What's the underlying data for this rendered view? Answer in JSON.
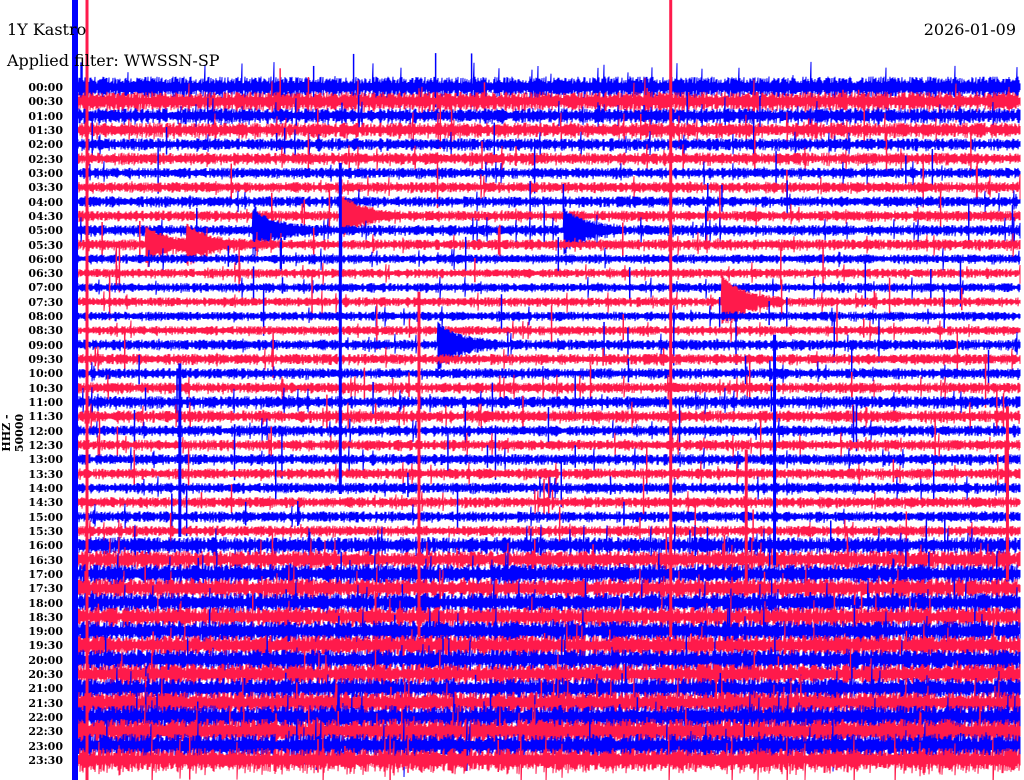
{
  "header": {
    "station": "1Y Kastro",
    "filter": "Applied filter: WWSSN-SP",
    "date": "2026-01-09"
  },
  "chart_data": {
    "type": "line",
    "title": "1Y Kastro helicorder",
    "channel_label": "HHZ - 50000",
    "minutes_per_line": 30,
    "row_labels": [
      "00:00",
      "00:30",
      "01:00",
      "01:30",
      "02:00",
      "02:30",
      "03:00",
      "03:30",
      "04:00",
      "04:30",
      "05:00",
      "05:30",
      "06:00",
      "06:30",
      "07:00",
      "07:30",
      "08:00",
      "08:30",
      "09:00",
      "09:30",
      "10:00",
      "10:30",
      "11:00",
      "11:30",
      "12:00",
      "12:30",
      "13:00",
      "13:30",
      "14:00",
      "14:30",
      "15:00",
      "15:30",
      "16:00",
      "16:30",
      "17:00",
      "17:30",
      "18:00",
      "18:30",
      "19:00",
      "19:30",
      "20:00",
      "20:30",
      "21:00",
      "21:30",
      "22:00",
      "22:30",
      "23:00",
      "23:30"
    ],
    "colors": [
      "#0000ff",
      "#ff1a4b"
    ],
    "relative_noise": [
      1.4,
      1.3,
      1.0,
      1.0,
      0.8,
      0.8,
      0.7,
      0.7,
      0.7,
      0.7,
      0.7,
      0.7,
      0.6,
      0.6,
      0.6,
      0.6,
      0.6,
      0.6,
      0.7,
      0.7,
      0.7,
      0.7,
      0.8,
      0.8,
      0.7,
      0.7,
      0.7,
      0.7,
      0.7,
      0.7,
      0.7,
      0.7,
      1.1,
      1.2,
      1.3,
      1.3,
      1.3,
      1.3,
      1.4,
      1.4,
      1.4,
      1.4,
      1.4,
      1.5,
      1.6,
      1.7,
      1.6,
      1.6
    ],
    "events": [
      {
        "row": 10,
        "minute": 5.6,
        "amp": 3
      },
      {
        "row": 10,
        "minute": 15.5,
        "amp": 3
      },
      {
        "row": 15,
        "minute": 20.5,
        "amp": 4
      },
      {
        "row": 18,
        "minute": 11.5,
        "amp": 3
      },
      {
        "row": 9,
        "minute": 8.4,
        "amp": 3
      },
      {
        "row": 11,
        "minute": 2.2,
        "amp": 2.5
      },
      {
        "row": 11,
        "minute": 3.5,
        "amp": 2.5
      }
    ],
    "spike_columns": [
      {
        "minute": 0.0,
        "from_row": 0,
        "to_row": 47,
        "color": 0
      },
      {
        "minute": 0.35,
        "from_row": 0,
        "to_row": 47,
        "color": 1
      },
      {
        "minute": 18.9,
        "from_row": 0,
        "to_row": 38,
        "color": 1
      },
      {
        "minute": 22.2,
        "from_row": 18,
        "to_row": 33,
        "color": 0
      },
      {
        "minute": 21.3,
        "from_row": 26,
        "to_row": 35,
        "color": 1
      },
      {
        "minute": 10.9,
        "from_row": 15,
        "to_row": 38,
        "color": 1
      },
      {
        "minute": 3.3,
        "from_row": 20,
        "to_row": 31,
        "color": 0
      },
      {
        "minute": 29.6,
        "from_row": 23,
        "to_row": 34,
        "color": 1
      },
      {
        "minute": 8.4,
        "from_row": 6,
        "to_row": 28,
        "color": 0
      }
    ]
  }
}
